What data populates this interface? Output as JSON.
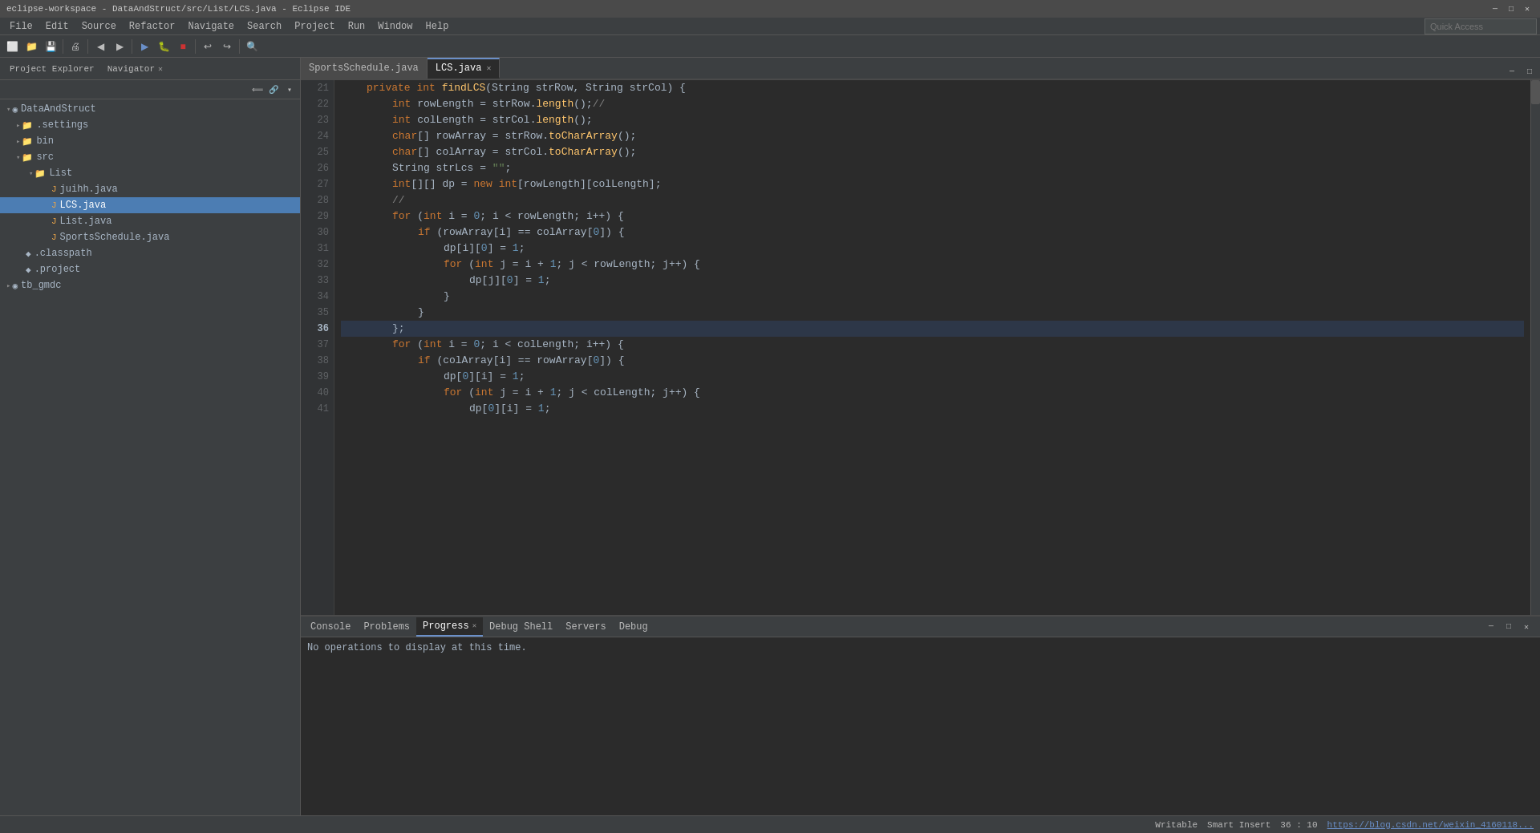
{
  "titleBar": {
    "title": "eclipse-workspace - DataAndStruct/src/List/LCS.java - Eclipse IDE",
    "minimizeLabel": "─",
    "maximizeLabel": "□",
    "closeLabel": "✕"
  },
  "menuBar": {
    "items": [
      "File",
      "Edit",
      "Source",
      "Refactor",
      "Navigate",
      "Search",
      "Project",
      "Run",
      "Window",
      "Help"
    ]
  },
  "quickAccess": {
    "placeholder": "Quick Access",
    "value": ""
  },
  "explorerTabs": [
    {
      "label": "Project Explorer",
      "active": false
    },
    {
      "label": "Navigator",
      "active": true,
      "closeable": true
    }
  ],
  "editorTabs": [
    {
      "label": "SportsSchedule.java",
      "active": false,
      "closeable": false
    },
    {
      "label": "LCS.java",
      "active": true,
      "closeable": true
    }
  ],
  "fileTree": [
    {
      "indent": 0,
      "icon": "▾",
      "type": "project",
      "label": "DataAndStruct",
      "expanded": true
    },
    {
      "indent": 1,
      "icon": "▾",
      "type": "folder",
      "label": ".settings",
      "expanded": false
    },
    {
      "indent": 1,
      "icon": "▾",
      "type": "folder",
      "label": "bin",
      "expanded": false
    },
    {
      "indent": 1,
      "icon": "▾",
      "type": "folder",
      "label": "src",
      "expanded": true
    },
    {
      "indent": 2,
      "icon": "▾",
      "type": "folder",
      "label": "List",
      "expanded": true
    },
    {
      "indent": 3,
      "icon": " ",
      "type": "file-j",
      "label": "juihh.java"
    },
    {
      "indent": 3,
      "icon": " ",
      "type": "file-selected",
      "label": "LCS.java",
      "selected": true
    },
    {
      "indent": 3,
      "icon": " ",
      "type": "file-j",
      "label": "List.java"
    },
    {
      "indent": 3,
      "icon": " ",
      "type": "file-j",
      "label": "SportsSchedule.java"
    },
    {
      "indent": 1,
      "icon": " ",
      "type": "file-cp",
      "label": ".classpath"
    },
    {
      "indent": 1,
      "icon": " ",
      "type": "file-cp",
      "label": ".project"
    },
    {
      "indent": 0,
      "icon": "▾",
      "type": "project",
      "label": "tb_gmdc",
      "expanded": false
    }
  ],
  "codeLines": [
    {
      "num": "21",
      "content": "private_int_findLCS_STRING",
      "tokens": [
        {
          "text": "\tprivate ",
          "cls": "kw"
        },
        {
          "text": "int ",
          "cls": "kw-type"
        },
        {
          "text": "findLCS",
          "cls": "fn"
        },
        {
          "text": "(",
          "cls": "punc"
        },
        {
          "text": "String ",
          "cls": "type-name"
        },
        {
          "text": "strRow, ",
          "cls": "var"
        },
        {
          "text": "String ",
          "cls": "type-name"
        },
        {
          "text": "strCol) {",
          "cls": "var"
        }
      ]
    },
    {
      "num": "22",
      "content": "rowLength",
      "tokens": [
        {
          "text": "\t\t",
          "cls": ""
        },
        {
          "text": "int ",
          "cls": "kw-type"
        },
        {
          "text": "rowLength = strRow.",
          "cls": "var"
        },
        {
          "text": "length",
          "cls": "method"
        },
        {
          "text": "();",
          "cls": "punc"
        },
        {
          "text": "//",
          "cls": "comment"
        }
      ]
    },
    {
      "num": "23",
      "content": "colLength",
      "tokens": [
        {
          "text": "\t\t",
          "cls": ""
        },
        {
          "text": "int ",
          "cls": "kw-type"
        },
        {
          "text": "colLength = strCol.",
          "cls": "var"
        },
        {
          "text": "length",
          "cls": "method"
        },
        {
          "text": "();",
          "cls": "punc"
        }
      ]
    },
    {
      "num": "24",
      "content": "rowArray",
      "tokens": [
        {
          "text": "\t\t",
          "cls": ""
        },
        {
          "text": "char",
          "cls": "kw-type"
        },
        {
          "text": "[] rowArray = strRow.",
          "cls": "var"
        },
        {
          "text": "toCharArray",
          "cls": "method"
        },
        {
          "text": "();",
          "cls": "punc"
        }
      ]
    },
    {
      "num": "25",
      "content": "colArray",
      "tokens": [
        {
          "text": "\t\t",
          "cls": ""
        },
        {
          "text": "char",
          "cls": "kw-type"
        },
        {
          "text": "[] colArray = strCol.",
          "cls": "var"
        },
        {
          "text": "toCharArray",
          "cls": "method"
        },
        {
          "text": "();",
          "cls": "punc"
        }
      ]
    },
    {
      "num": "26",
      "content": "strLcs",
      "tokens": [
        {
          "text": "\t\t",
          "cls": ""
        },
        {
          "text": "String ",
          "cls": "type-name"
        },
        {
          "text": "strLcs = ",
          "cls": "var"
        },
        {
          "text": "\"\"",
          "cls": "str"
        },
        {
          "text": ";",
          "cls": "punc"
        }
      ]
    },
    {
      "num": "27",
      "content": "dp",
      "tokens": [
        {
          "text": "\t\t",
          "cls": ""
        },
        {
          "text": "int",
          "cls": "kw-type"
        },
        {
          "text": "[][] dp = ",
          "cls": "var"
        },
        {
          "text": "new ",
          "cls": "kw"
        },
        {
          "text": "int",
          "cls": "kw-type"
        },
        {
          "text": "[rowLength][colLength];",
          "cls": "var"
        }
      ]
    },
    {
      "num": "28",
      "content": "blank",
      "tokens": [
        {
          "text": "",
          "cls": ""
        }
      ]
    },
    {
      "num": "29",
      "content": "for1",
      "tokens": [
        {
          "text": "\t\t",
          "cls": ""
        },
        {
          "text": "for ",
          "cls": "kw"
        },
        {
          "text": "(",
          "cls": "punc"
        },
        {
          "text": "int ",
          "cls": "kw-type"
        },
        {
          "text": "i = ",
          "cls": "var"
        },
        {
          "text": "0",
          "cls": "num"
        },
        {
          "text": "; i < rowLength; i++) {",
          "cls": "var"
        }
      ]
    },
    {
      "num": "30",
      "content": "if1",
      "tokens": [
        {
          "text": "\t\t\t",
          "cls": ""
        },
        {
          "text": "if ",
          "cls": "kw"
        },
        {
          "text": "(rowArray[i] == colArray[",
          "cls": "var"
        },
        {
          "text": "0",
          "cls": "num"
        },
        {
          "text": "]) {",
          "cls": "punc"
        }
      ]
    },
    {
      "num": "31",
      "content": "dp1",
      "tokens": [
        {
          "text": "\t\t\t\t",
          "cls": ""
        },
        {
          "text": "dp[i][",
          "cls": "var"
        },
        {
          "text": "0",
          "cls": "num"
        },
        {
          "text": "] = ",
          "cls": "var"
        },
        {
          "text": "1",
          "cls": "num"
        },
        {
          "text": ";",
          "cls": "punc"
        }
      ]
    },
    {
      "num": "32",
      "content": "for2",
      "tokens": [
        {
          "text": "\t\t\t\t",
          "cls": ""
        },
        {
          "text": "for ",
          "cls": "kw"
        },
        {
          "text": "(",
          "cls": "punc"
        },
        {
          "text": "int ",
          "cls": "kw-type"
        },
        {
          "text": "j = i + ",
          "cls": "var"
        },
        {
          "text": "1",
          "cls": "num"
        },
        {
          "text": "; j < rowLength; j++) {",
          "cls": "var"
        }
      ]
    },
    {
      "num": "33",
      "content": "dp2",
      "tokens": [
        {
          "text": "\t\t\t\t\t",
          "cls": ""
        },
        {
          "text": "dp[j][",
          "cls": "var"
        },
        {
          "text": "0",
          "cls": "num"
        },
        {
          "text": "] = ",
          "cls": "var"
        },
        {
          "text": "1",
          "cls": "num"
        },
        {
          "text": ";",
          "cls": "punc"
        }
      ]
    },
    {
      "num": "34",
      "content": "brace1",
      "tokens": [
        {
          "text": "\t\t\t\t",
          "cls": ""
        },
        {
          "text": "}",
          "cls": "punc"
        }
      ]
    },
    {
      "num": "35",
      "content": "brace2",
      "tokens": [
        {
          "text": "\t\t\t",
          "cls": ""
        },
        {
          "text": "}",
          "cls": "punc"
        }
      ]
    },
    {
      "num": "36",
      "content": "brace3-highlight",
      "tokens": [
        {
          "text": "\t\t",
          "cls": ""
        },
        {
          "text": "};",
          "cls": "punc"
        }
      ],
      "highlighted": true
    },
    {
      "num": "37",
      "content": "for3",
      "tokens": [
        {
          "text": "\t\t",
          "cls": ""
        },
        {
          "text": "for ",
          "cls": "kw"
        },
        {
          "text": "(",
          "cls": "punc"
        },
        {
          "text": "int ",
          "cls": "kw-type"
        },
        {
          "text": "i = ",
          "cls": "var"
        },
        {
          "text": "0",
          "cls": "num"
        },
        {
          "text": "; i < colLength; i++) {",
          "cls": "var"
        }
      ]
    },
    {
      "num": "38",
      "content": "if2",
      "tokens": [
        {
          "text": "\t\t\t",
          "cls": ""
        },
        {
          "text": "if ",
          "cls": "kw"
        },
        {
          "text": "(colArray[i] == rowArray[",
          "cls": "var"
        },
        {
          "text": "0",
          "cls": "num"
        },
        {
          "text": "]) {",
          "cls": "punc"
        }
      ]
    },
    {
      "num": "39",
      "content": "dp3",
      "tokens": [
        {
          "text": "\t\t\t\t",
          "cls": ""
        },
        {
          "text": "dp[",
          "cls": "var"
        },
        {
          "text": "0",
          "cls": "num"
        },
        {
          "text": "][i] = ",
          "cls": "var"
        },
        {
          "text": "1",
          "cls": "num"
        },
        {
          "text": ";",
          "cls": "punc"
        }
      ]
    },
    {
      "num": "40",
      "content": "for4",
      "tokens": [
        {
          "text": "\t\t\t\t",
          "cls": ""
        },
        {
          "text": "for ",
          "cls": "kw"
        },
        {
          "text": "(",
          "cls": "punc"
        },
        {
          "text": "int ",
          "cls": "kw-type"
        },
        {
          "text": "j = i + ",
          "cls": "var"
        },
        {
          "text": "1",
          "cls": "num"
        },
        {
          "text": "; j < colLength; j++) {",
          "cls": "var"
        }
      ]
    },
    {
      "num": "41",
      "content": "dp4partial",
      "tokens": [
        {
          "text": "\t\t\t\t\t",
          "cls": ""
        },
        {
          "text": "dp[",
          "cls": "var"
        },
        {
          "text": "0",
          "cls": "num"
        },
        {
          "text": "][i] = ",
          "cls": "var"
        },
        {
          "text": "1",
          "cls": "num"
        },
        {
          "text": ";",
          "cls": "punc"
        }
      ]
    }
  ],
  "bottomTabs": [
    {
      "label": "Console",
      "active": false
    },
    {
      "label": "Problems",
      "active": false
    },
    {
      "label": "Progress",
      "active": true,
      "closeable": true
    },
    {
      "label": "Debug Shell",
      "active": false
    },
    {
      "label": "Servers",
      "active": false
    },
    {
      "label": "Debug",
      "active": false
    }
  ],
  "bottomContent": {
    "message": "No operations to display at this time."
  },
  "statusBar": {
    "writable": "Writable",
    "insertMode": "Smart Insert",
    "position": "36 : 10",
    "link": "https://blog.csdn.net/weixin_4160118..."
  }
}
